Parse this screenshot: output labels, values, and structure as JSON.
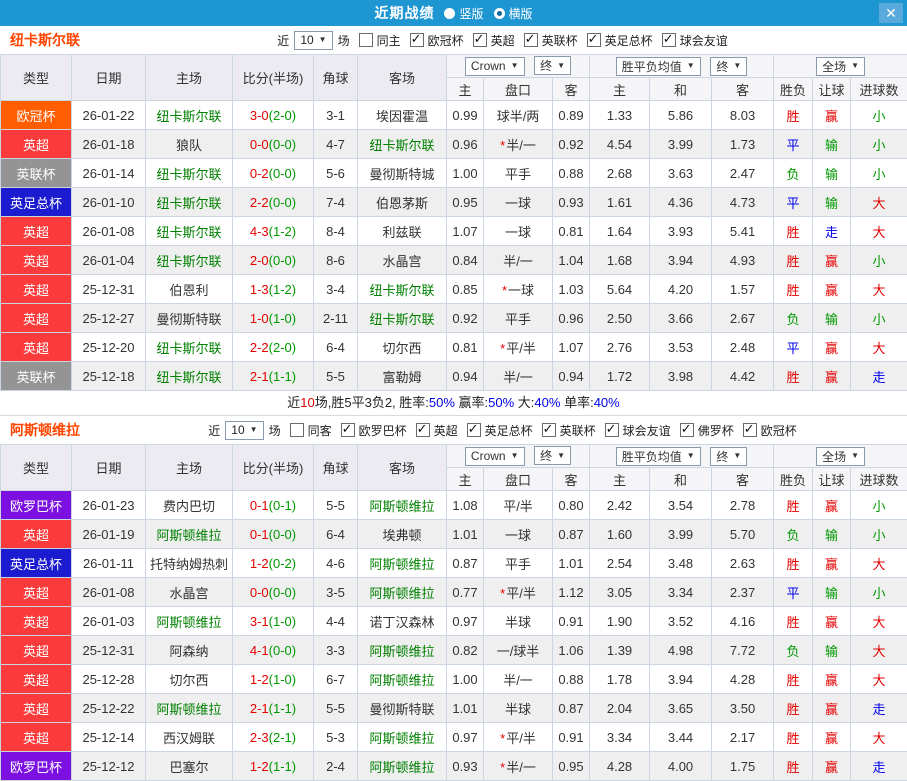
{
  "titlebar": {
    "title": "近期战绩",
    "vertical_label": "竖版",
    "horizontal_label": "横版",
    "selected_layout": "横版",
    "close_glyph": "✕"
  },
  "colors": {
    "accent": "#1e96d2",
    "team_name": "#ff4500",
    "team_green": "#008000",
    "red": "#e60000",
    "green": "#009900",
    "blue": "#0000ee",
    "dark": "#222222"
  },
  "type_colors": {
    "欧冠杯": "#ff5d00",
    "英超": "#fb3b3b",
    "英联杯": "#949494",
    "英足总杯": "#1b1bd0",
    "欧罗巴杯": "#7b10e0"
  },
  "table_header": {
    "main_cols": [
      "类型",
      "日期",
      "主场",
      "比分(半场)",
      "角球",
      "客场"
    ],
    "ah_select": "Crown",
    "ah_final": "终",
    "eu_select": "胜平负均值",
    "eu_final": "终",
    "scope_select": "全场",
    "sub_cols": [
      "主",
      "盘口",
      "客",
      "主",
      "和",
      "客",
      "胜负",
      "让球",
      "进球数"
    ]
  },
  "teams": [
    {
      "name": "纽卡斯尔联",
      "filter": {
        "near_label": "近",
        "games": "10",
        "games_suffix": "场",
        "same_label": "同主",
        "same_checked": false,
        "competitions": [
          "欧冠杯",
          "英超",
          "英联杯",
          "英足总杯",
          "球会友谊"
        ]
      },
      "rows": [
        {
          "type": "欧冠杯",
          "date": "26-01-22",
          "home": "纽卡斯尔联",
          "home_hl": true,
          "score": "3-0",
          "half": "(2-0)",
          "corner": "3-1",
          "away": "埃因霍温",
          "away_hl": false,
          "ah": [
            "0.99",
            "球半/两",
            "0.89"
          ],
          "star": false,
          "eu": [
            "1.33",
            "5.86",
            "8.03"
          ],
          "res": [
            "胜",
            "赢",
            "小"
          ],
          "res_c": [
            "red",
            "red",
            "green"
          ]
        },
        {
          "type": "英超",
          "date": "26-01-18",
          "home": "狼队",
          "home_hl": false,
          "score": "0-0",
          "half": "(0-0)",
          "corner": "4-7",
          "away": "纽卡斯尔联",
          "away_hl": true,
          "ah": [
            "0.96",
            "半/一",
            "0.92"
          ],
          "star": true,
          "eu": [
            "4.54",
            "3.99",
            "1.73"
          ],
          "res": [
            "平",
            "输",
            "小"
          ],
          "res_c": [
            "blue",
            "green",
            "green"
          ]
        },
        {
          "type": "英联杯",
          "date": "26-01-14",
          "home": "纽卡斯尔联",
          "home_hl": true,
          "score": "0-2",
          "half": "(0-0)",
          "corner": "5-6",
          "away": "曼彻斯特城",
          "away_hl": false,
          "ah": [
            "1.00",
            "平手",
            "0.88"
          ],
          "star": false,
          "eu": [
            "2.68",
            "3.63",
            "2.47"
          ],
          "res": [
            "负",
            "输",
            "小"
          ],
          "res_c": [
            "green",
            "green",
            "green"
          ]
        },
        {
          "type": "英足总杯",
          "date": "26-01-10",
          "home": "纽卡斯尔联",
          "home_hl": true,
          "score": "2-2",
          "half": "(0-0)",
          "corner": "7-4",
          "away": "伯恩茅斯",
          "away_hl": false,
          "ah": [
            "0.95",
            "一球",
            "0.93"
          ],
          "star": false,
          "eu": [
            "1.61",
            "4.36",
            "4.73"
          ],
          "res": [
            "平",
            "输",
            "大"
          ],
          "res_c": [
            "blue",
            "green",
            "red"
          ]
        },
        {
          "type": "英超",
          "date": "26-01-08",
          "home": "纽卡斯尔联",
          "home_hl": true,
          "score": "4-3",
          "half": "(1-2)",
          "corner": "8-4",
          "away": "利兹联",
          "away_hl": false,
          "ah": [
            "1.07",
            "一球",
            "0.81"
          ],
          "star": false,
          "eu": [
            "1.64",
            "3.93",
            "5.41"
          ],
          "res": [
            "胜",
            "走",
            "大"
          ],
          "res_c": [
            "red",
            "blue",
            "red"
          ]
        },
        {
          "type": "英超",
          "date": "26-01-04",
          "home": "纽卡斯尔联",
          "home_hl": true,
          "score": "2-0",
          "half": "(0-0)",
          "corner": "8-6",
          "away": "水晶宫",
          "away_hl": false,
          "ah": [
            "0.84",
            "半/一",
            "1.04"
          ],
          "star": false,
          "eu": [
            "1.68",
            "3.94",
            "4.93"
          ],
          "res": [
            "胜",
            "赢",
            "小"
          ],
          "res_c": [
            "red",
            "red",
            "green"
          ]
        },
        {
          "type": "英超",
          "date": "25-12-31",
          "home": "伯恩利",
          "home_hl": false,
          "score": "1-3",
          "half": "(1-2)",
          "corner": "3-4",
          "away": "纽卡斯尔联",
          "away_hl": true,
          "ah": [
            "0.85",
            "一球",
            "1.03"
          ],
          "star": true,
          "eu": [
            "5.64",
            "4.20",
            "1.57"
          ],
          "res": [
            "胜",
            "赢",
            "大"
          ],
          "res_c": [
            "red",
            "red",
            "red"
          ]
        },
        {
          "type": "英超",
          "date": "25-12-27",
          "home": "曼彻斯特联",
          "home_hl": false,
          "score": "1-0",
          "half": "(1-0)",
          "corner": "2-11",
          "away": "纽卡斯尔联",
          "away_hl": true,
          "ah": [
            "0.92",
            "平手",
            "0.96"
          ],
          "star": false,
          "eu": [
            "2.50",
            "3.66",
            "2.67"
          ],
          "res": [
            "负",
            "输",
            "小"
          ],
          "res_c": [
            "green",
            "green",
            "green"
          ]
        },
        {
          "type": "英超",
          "date": "25-12-20",
          "home": "纽卡斯尔联",
          "home_hl": true,
          "score": "2-2",
          "half": "(2-0)",
          "corner": "6-4",
          "away": "切尔西",
          "away_hl": false,
          "ah": [
            "0.81",
            "平/半",
            "1.07"
          ],
          "star": true,
          "eu": [
            "2.76",
            "3.53",
            "2.48"
          ],
          "res": [
            "平",
            "赢",
            "大"
          ],
          "res_c": [
            "blue",
            "red",
            "red"
          ]
        },
        {
          "type": "英联杯",
          "date": "25-12-18",
          "home": "纽卡斯尔联",
          "home_hl": true,
          "score": "2-1",
          "half": "(1-1)",
          "corner": "5-5",
          "away": "富勒姆",
          "away_hl": false,
          "ah": [
            "0.94",
            "半/一",
            "0.94"
          ],
          "star": false,
          "eu": [
            "1.72",
            "3.98",
            "4.42"
          ],
          "res": [
            "胜",
            "赢",
            "走"
          ],
          "res_c": [
            "red",
            "red",
            "blue"
          ]
        }
      ],
      "summary_parts": [
        [
          "近",
          "dark"
        ],
        [
          "10",
          "red"
        ],
        [
          "场,胜5平3负2, 胜率:",
          "dark"
        ],
        [
          "50%",
          "blue"
        ],
        [
          " 赢率:",
          "dark"
        ],
        [
          "50%",
          "blue"
        ],
        [
          " 大:",
          "dark"
        ],
        [
          "40%",
          "blue"
        ],
        [
          " 单率:",
          "dark"
        ],
        [
          "40%",
          "blue"
        ]
      ]
    },
    {
      "name": "阿斯顿维拉",
      "filter": {
        "near_label": "近",
        "games": "10",
        "games_suffix": "场",
        "same_label": "同客",
        "same_checked": false,
        "competitions": [
          "欧罗巴杯",
          "英超",
          "英足总杯",
          "英联杯",
          "球会友谊",
          "佛罗杯",
          "欧冠杯"
        ]
      },
      "rows": [
        {
          "type": "欧罗巴杯",
          "date": "26-01-23",
          "home": "费内巴切",
          "home_hl": false,
          "score": "0-1",
          "half": "(0-1)",
          "corner": "5-5",
          "away": "阿斯顿维拉",
          "away_hl": true,
          "ah": [
            "1.08",
            "平/半",
            "0.80"
          ],
          "star": false,
          "eu": [
            "2.42",
            "3.54",
            "2.78"
          ],
          "res": [
            "胜",
            "赢",
            "小"
          ],
          "res_c": [
            "red",
            "red",
            "green"
          ]
        },
        {
          "type": "英超",
          "date": "26-01-19",
          "home": "阿斯顿维拉",
          "home_hl": true,
          "score": "0-1",
          "half": "(0-0)",
          "corner": "6-4",
          "away": "埃弗顿",
          "away_hl": false,
          "ah": [
            "1.01",
            "一球",
            "0.87"
          ],
          "star": false,
          "eu": [
            "1.60",
            "3.99",
            "5.70"
          ],
          "res": [
            "负",
            "输",
            "小"
          ],
          "res_c": [
            "green",
            "green",
            "green"
          ]
        },
        {
          "type": "英足总杯",
          "date": "26-01-11",
          "home": "托特纳姆热刺",
          "home_hl": false,
          "score": "1-2",
          "half": "(0-2)",
          "corner": "4-6",
          "away": "阿斯顿维拉",
          "away_hl": true,
          "ah": [
            "0.87",
            "平手",
            "1.01"
          ],
          "star": false,
          "eu": [
            "2.54",
            "3.48",
            "2.63"
          ],
          "res": [
            "胜",
            "赢",
            "大"
          ],
          "res_c": [
            "red",
            "red",
            "red"
          ]
        },
        {
          "type": "英超",
          "date": "26-01-08",
          "home": "水晶宫",
          "home_hl": false,
          "score": "0-0",
          "half": "(0-0)",
          "corner": "3-5",
          "away": "阿斯顿维拉",
          "away_hl": true,
          "ah": [
            "0.77",
            "平/半",
            "1.12"
          ],
          "star": true,
          "eu": [
            "3.05",
            "3.34",
            "2.37"
          ],
          "res": [
            "平",
            "输",
            "小"
          ],
          "res_c": [
            "blue",
            "green",
            "green"
          ]
        },
        {
          "type": "英超",
          "date": "26-01-03",
          "home": "阿斯顿维拉",
          "home_hl": true,
          "score": "3-1",
          "half": "(1-0)",
          "corner": "4-4",
          "away": "诺丁汉森林",
          "away_hl": false,
          "ah": [
            "0.97",
            "半球",
            "0.91"
          ],
          "star": false,
          "eu": [
            "1.90",
            "3.52",
            "4.16"
          ],
          "res": [
            "胜",
            "赢",
            "大"
          ],
          "res_c": [
            "red",
            "red",
            "red"
          ]
        },
        {
          "type": "英超",
          "date": "25-12-31",
          "home": "阿森纳",
          "home_hl": false,
          "score": "4-1",
          "half": "(0-0)",
          "corner": "3-3",
          "away": "阿斯顿维拉",
          "away_hl": true,
          "ah": [
            "0.82",
            "一/球半",
            "1.06"
          ],
          "star": false,
          "eu": [
            "1.39",
            "4.98",
            "7.72"
          ],
          "res": [
            "负",
            "输",
            "大"
          ],
          "res_c": [
            "green",
            "green",
            "red"
          ]
        },
        {
          "type": "英超",
          "date": "25-12-28",
          "home": "切尔西",
          "home_hl": false,
          "score": "1-2",
          "half": "(1-0)",
          "corner": "6-7",
          "away": "阿斯顿维拉",
          "away_hl": true,
          "ah": [
            "1.00",
            "半/一",
            "0.88"
          ],
          "star": false,
          "eu": [
            "1.78",
            "3.94",
            "4.28"
          ],
          "res": [
            "胜",
            "赢",
            "大"
          ],
          "res_c": [
            "red",
            "red",
            "red"
          ]
        },
        {
          "type": "英超",
          "date": "25-12-22",
          "home": "阿斯顿维拉",
          "home_hl": true,
          "score": "2-1",
          "half": "(1-1)",
          "corner": "5-5",
          "away": "曼彻斯特联",
          "away_hl": false,
          "ah": [
            "1.01",
            "半球",
            "0.87"
          ],
          "star": false,
          "eu": [
            "2.04",
            "3.65",
            "3.50"
          ],
          "res": [
            "胜",
            "赢",
            "走"
          ],
          "res_c": [
            "red",
            "red",
            "blue"
          ]
        },
        {
          "type": "英超",
          "date": "25-12-14",
          "home": "西汉姆联",
          "home_hl": false,
          "score": "2-3",
          "half": "(2-1)",
          "corner": "5-3",
          "away": "阿斯顿维拉",
          "away_hl": true,
          "ah": [
            "0.97",
            "平/半",
            "0.91"
          ],
          "star": true,
          "eu": [
            "3.34",
            "3.44",
            "2.17"
          ],
          "res": [
            "胜",
            "赢",
            "大"
          ],
          "res_c": [
            "red",
            "red",
            "red"
          ]
        },
        {
          "type": "欧罗巴杯",
          "date": "25-12-12",
          "home": "巴塞尔",
          "home_hl": false,
          "score": "1-2",
          "half": "(1-1)",
          "corner": "2-4",
          "away": "阿斯顿维拉",
          "away_hl": true,
          "ah": [
            "0.93",
            "半/一",
            "0.95"
          ],
          "star": true,
          "eu": [
            "4.28",
            "4.00",
            "1.75"
          ],
          "res": [
            "胜",
            "赢",
            "走"
          ],
          "res_c": [
            "red",
            "red",
            "blue"
          ]
        }
      ]
    }
  ]
}
